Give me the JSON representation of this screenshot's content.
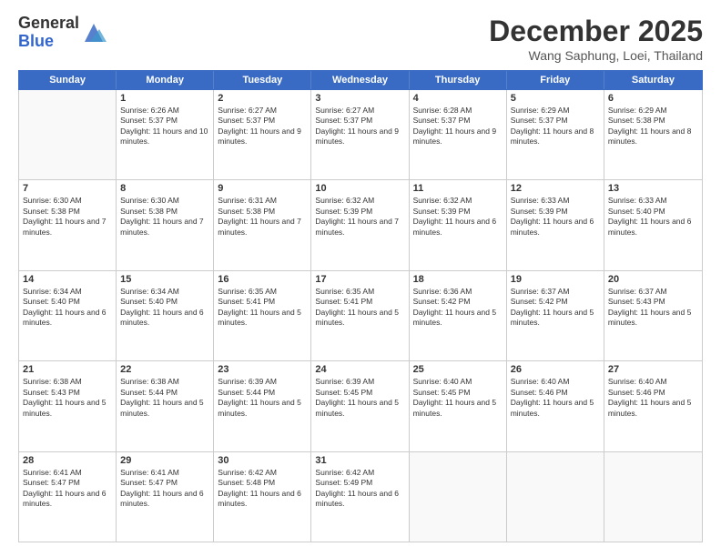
{
  "header": {
    "logo_general": "General",
    "logo_blue": "Blue",
    "month_title": "December 2025",
    "location": "Wang Saphung, Loei, Thailand"
  },
  "calendar": {
    "days_of_week": [
      "Sunday",
      "Monday",
      "Tuesday",
      "Wednesday",
      "Thursday",
      "Friday",
      "Saturday"
    ],
    "weeks": [
      [
        {
          "day": "",
          "empty": true
        },
        {
          "day": "1",
          "sunrise": "Sunrise: 6:26 AM",
          "sunset": "Sunset: 5:37 PM",
          "daylight": "Daylight: 11 hours and 10 minutes."
        },
        {
          "day": "2",
          "sunrise": "Sunrise: 6:27 AM",
          "sunset": "Sunset: 5:37 PM",
          "daylight": "Daylight: 11 hours and 9 minutes."
        },
        {
          "day": "3",
          "sunrise": "Sunrise: 6:27 AM",
          "sunset": "Sunset: 5:37 PM",
          "daylight": "Daylight: 11 hours and 9 minutes."
        },
        {
          "day": "4",
          "sunrise": "Sunrise: 6:28 AM",
          "sunset": "Sunset: 5:37 PM",
          "daylight": "Daylight: 11 hours and 9 minutes."
        },
        {
          "day": "5",
          "sunrise": "Sunrise: 6:29 AM",
          "sunset": "Sunset: 5:37 PM",
          "daylight": "Daylight: 11 hours and 8 minutes."
        },
        {
          "day": "6",
          "sunrise": "Sunrise: 6:29 AM",
          "sunset": "Sunset: 5:38 PM",
          "daylight": "Daylight: 11 hours and 8 minutes."
        }
      ],
      [
        {
          "day": "7",
          "sunrise": "Sunrise: 6:30 AM",
          "sunset": "Sunset: 5:38 PM",
          "daylight": "Daylight: 11 hours and 7 minutes."
        },
        {
          "day": "8",
          "sunrise": "Sunrise: 6:30 AM",
          "sunset": "Sunset: 5:38 PM",
          "daylight": "Daylight: 11 hours and 7 minutes."
        },
        {
          "day": "9",
          "sunrise": "Sunrise: 6:31 AM",
          "sunset": "Sunset: 5:38 PM",
          "daylight": "Daylight: 11 hours and 7 minutes."
        },
        {
          "day": "10",
          "sunrise": "Sunrise: 6:32 AM",
          "sunset": "Sunset: 5:39 PM",
          "daylight": "Daylight: 11 hours and 7 minutes."
        },
        {
          "day": "11",
          "sunrise": "Sunrise: 6:32 AM",
          "sunset": "Sunset: 5:39 PM",
          "daylight": "Daylight: 11 hours and 6 minutes."
        },
        {
          "day": "12",
          "sunrise": "Sunrise: 6:33 AM",
          "sunset": "Sunset: 5:39 PM",
          "daylight": "Daylight: 11 hours and 6 minutes."
        },
        {
          "day": "13",
          "sunrise": "Sunrise: 6:33 AM",
          "sunset": "Sunset: 5:40 PM",
          "daylight": "Daylight: 11 hours and 6 minutes."
        }
      ],
      [
        {
          "day": "14",
          "sunrise": "Sunrise: 6:34 AM",
          "sunset": "Sunset: 5:40 PM",
          "daylight": "Daylight: 11 hours and 6 minutes."
        },
        {
          "day": "15",
          "sunrise": "Sunrise: 6:34 AM",
          "sunset": "Sunset: 5:40 PM",
          "daylight": "Daylight: 11 hours and 6 minutes."
        },
        {
          "day": "16",
          "sunrise": "Sunrise: 6:35 AM",
          "sunset": "Sunset: 5:41 PM",
          "daylight": "Daylight: 11 hours and 5 minutes."
        },
        {
          "day": "17",
          "sunrise": "Sunrise: 6:35 AM",
          "sunset": "Sunset: 5:41 PM",
          "daylight": "Daylight: 11 hours and 5 minutes."
        },
        {
          "day": "18",
          "sunrise": "Sunrise: 6:36 AM",
          "sunset": "Sunset: 5:42 PM",
          "daylight": "Daylight: 11 hours and 5 minutes."
        },
        {
          "day": "19",
          "sunrise": "Sunrise: 6:37 AM",
          "sunset": "Sunset: 5:42 PM",
          "daylight": "Daylight: 11 hours and 5 minutes."
        },
        {
          "day": "20",
          "sunrise": "Sunrise: 6:37 AM",
          "sunset": "Sunset: 5:43 PM",
          "daylight": "Daylight: 11 hours and 5 minutes."
        }
      ],
      [
        {
          "day": "21",
          "sunrise": "Sunrise: 6:38 AM",
          "sunset": "Sunset: 5:43 PM",
          "daylight": "Daylight: 11 hours and 5 minutes."
        },
        {
          "day": "22",
          "sunrise": "Sunrise: 6:38 AM",
          "sunset": "Sunset: 5:44 PM",
          "daylight": "Daylight: 11 hours and 5 minutes."
        },
        {
          "day": "23",
          "sunrise": "Sunrise: 6:39 AM",
          "sunset": "Sunset: 5:44 PM",
          "daylight": "Daylight: 11 hours and 5 minutes."
        },
        {
          "day": "24",
          "sunrise": "Sunrise: 6:39 AM",
          "sunset": "Sunset: 5:45 PM",
          "daylight": "Daylight: 11 hours and 5 minutes."
        },
        {
          "day": "25",
          "sunrise": "Sunrise: 6:40 AM",
          "sunset": "Sunset: 5:45 PM",
          "daylight": "Daylight: 11 hours and 5 minutes."
        },
        {
          "day": "26",
          "sunrise": "Sunrise: 6:40 AM",
          "sunset": "Sunset: 5:46 PM",
          "daylight": "Daylight: 11 hours and 5 minutes."
        },
        {
          "day": "27",
          "sunrise": "Sunrise: 6:40 AM",
          "sunset": "Sunset: 5:46 PM",
          "daylight": "Daylight: 11 hours and 5 minutes."
        }
      ],
      [
        {
          "day": "28",
          "sunrise": "Sunrise: 6:41 AM",
          "sunset": "Sunset: 5:47 PM",
          "daylight": "Daylight: 11 hours and 6 minutes."
        },
        {
          "day": "29",
          "sunrise": "Sunrise: 6:41 AM",
          "sunset": "Sunset: 5:47 PM",
          "daylight": "Daylight: 11 hours and 6 minutes."
        },
        {
          "day": "30",
          "sunrise": "Sunrise: 6:42 AM",
          "sunset": "Sunset: 5:48 PM",
          "daylight": "Daylight: 11 hours and 6 minutes."
        },
        {
          "day": "31",
          "sunrise": "Sunrise: 6:42 AM",
          "sunset": "Sunset: 5:49 PM",
          "daylight": "Daylight: 11 hours and 6 minutes."
        },
        {
          "day": "",
          "empty": true
        },
        {
          "day": "",
          "empty": true
        },
        {
          "day": "",
          "empty": true
        }
      ]
    ]
  }
}
